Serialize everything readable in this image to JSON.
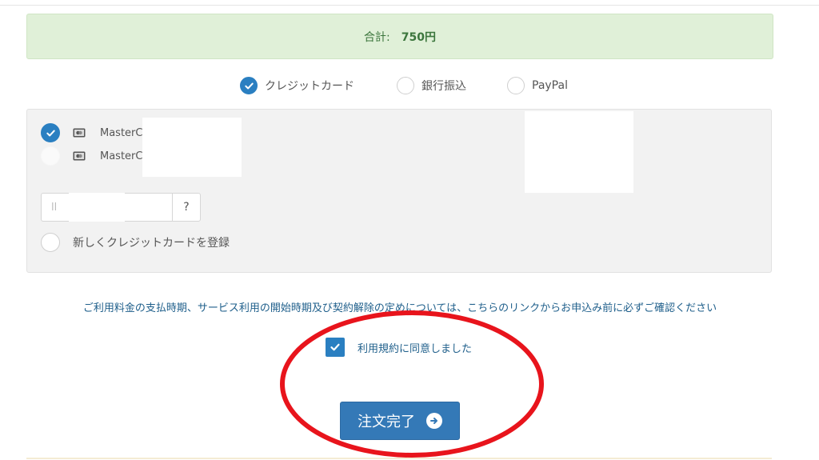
{
  "summary": {
    "total_label": "合計:",
    "total_value": "750円"
  },
  "payment_methods": [
    {
      "label": "クレジットカード",
      "selected": true
    },
    {
      "label": "銀行振込",
      "selected": false
    },
    {
      "label": "PayPal",
      "selected": false
    }
  ],
  "cards": [
    {
      "brand": "MasterC",
      "selected": true
    },
    {
      "brand": "MasterC",
      "selected": false
    }
  ],
  "cvc": {
    "value": "ll",
    "help_label": "?"
  },
  "new_card_label": "新しくクレジットカードを登録",
  "notice_text": "ご利用料金の支払時期、サービス利用の開始時期及び契約解除の定めについては、こちらのリンクからお申込み前に必ずご確認ください",
  "agreement": {
    "label": "利用規約に同意しました",
    "checked": true
  },
  "submit_label": "注文完了",
  "colors": {
    "primary": "#2a7fc1",
    "button": "#3479b7",
    "total_bg": "#e0f0d8",
    "total_text": "#3c763d",
    "annotation": "#e8141c"
  },
  "icons": {
    "check": "check-icon",
    "card": "credit-card-icon",
    "arrow": "arrow-right-circle-icon"
  }
}
